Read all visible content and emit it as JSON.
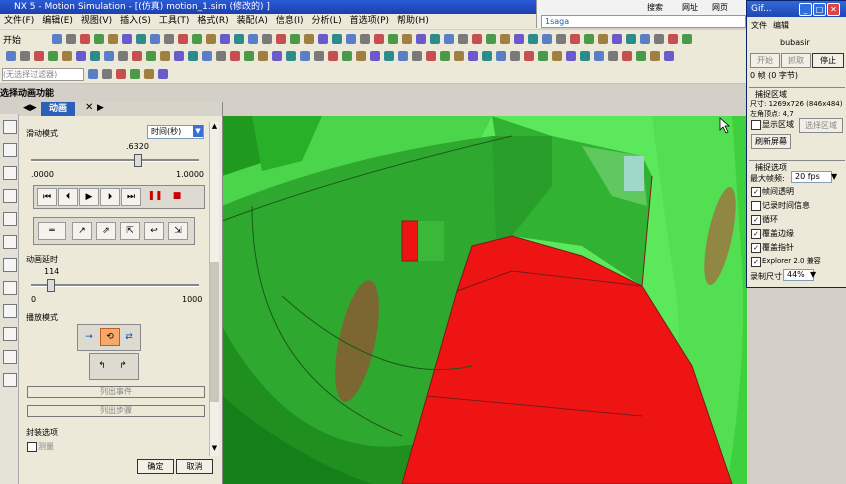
{
  "window": {
    "title": "NX 5 - Motion Simulation - [(仿真) motion_1.sim  (修改的) ]"
  },
  "menu": [
    "文件(F)",
    "编辑(E)",
    "视图(V)",
    "插入(S)",
    "工具(T)",
    "格式(R)",
    "装配(A)",
    "信息(I)",
    "分析(L)",
    "首选项(P)",
    "帮助(H)"
  ],
  "toolbar": {
    "start_label": "开始",
    "filter_text": "(无选择过滤器)",
    "task_label": "选择动画功能"
  },
  "browser": {
    "search_label": "搜索",
    "url_label": "网址",
    "site_label": "网页",
    "address_text": "1saga"
  },
  "panel": {
    "tab_label": "动画",
    "slide_mode_label": "滑动模式",
    "time_unit": "时间(秒)",
    "slider_value": ".6320",
    "slider_min": ".0000",
    "slider_max": "1.0000",
    "slider_fraction": 0.632,
    "delay_label": "动画延时",
    "delay_value": "114",
    "delay_min": "0",
    "delay_max": "1000",
    "delay_fraction": 0.114,
    "playback_label": "播放模式",
    "list_events_label": "列出事件",
    "list_steps_label": "列出步骤",
    "wrap_label": "封装选项",
    "measure_label": "测量",
    "ok_label": "确定",
    "cancel_label": "取消"
  },
  "gif": {
    "title": "Gif...",
    "menu_file": "文件",
    "menu_edit": "编辑",
    "author": "bubasir",
    "btn_start": "开始",
    "btn_capture": "抓取",
    "btn_stop": "停止",
    "frames": "0 帧 (0 字节)",
    "capture_area_label": "捕捉区域",
    "size_text": "尺寸: 1269x726 (846x484)",
    "topleft_text": "左角顶点:     4,7",
    "show_area_label": "显示区域",
    "select_area_label": "选择区域",
    "refresh_label": "刷新屏幕",
    "capture_options_label": "捕捉选项",
    "max_fps_label": "最大帧频:",
    "fps_value": "20 fps",
    "opt_transparent": "帧间透明",
    "opt_record_time": "记录时间信息",
    "opt_loop": "循环",
    "opt_cover_edge": "覆盖边缘",
    "opt_cover_pointer": "覆盖指针",
    "opt_explorer": "Explorer 2.0 兼容",
    "record_size_label": "录制尺寸",
    "record_size_value": "44%"
  }
}
